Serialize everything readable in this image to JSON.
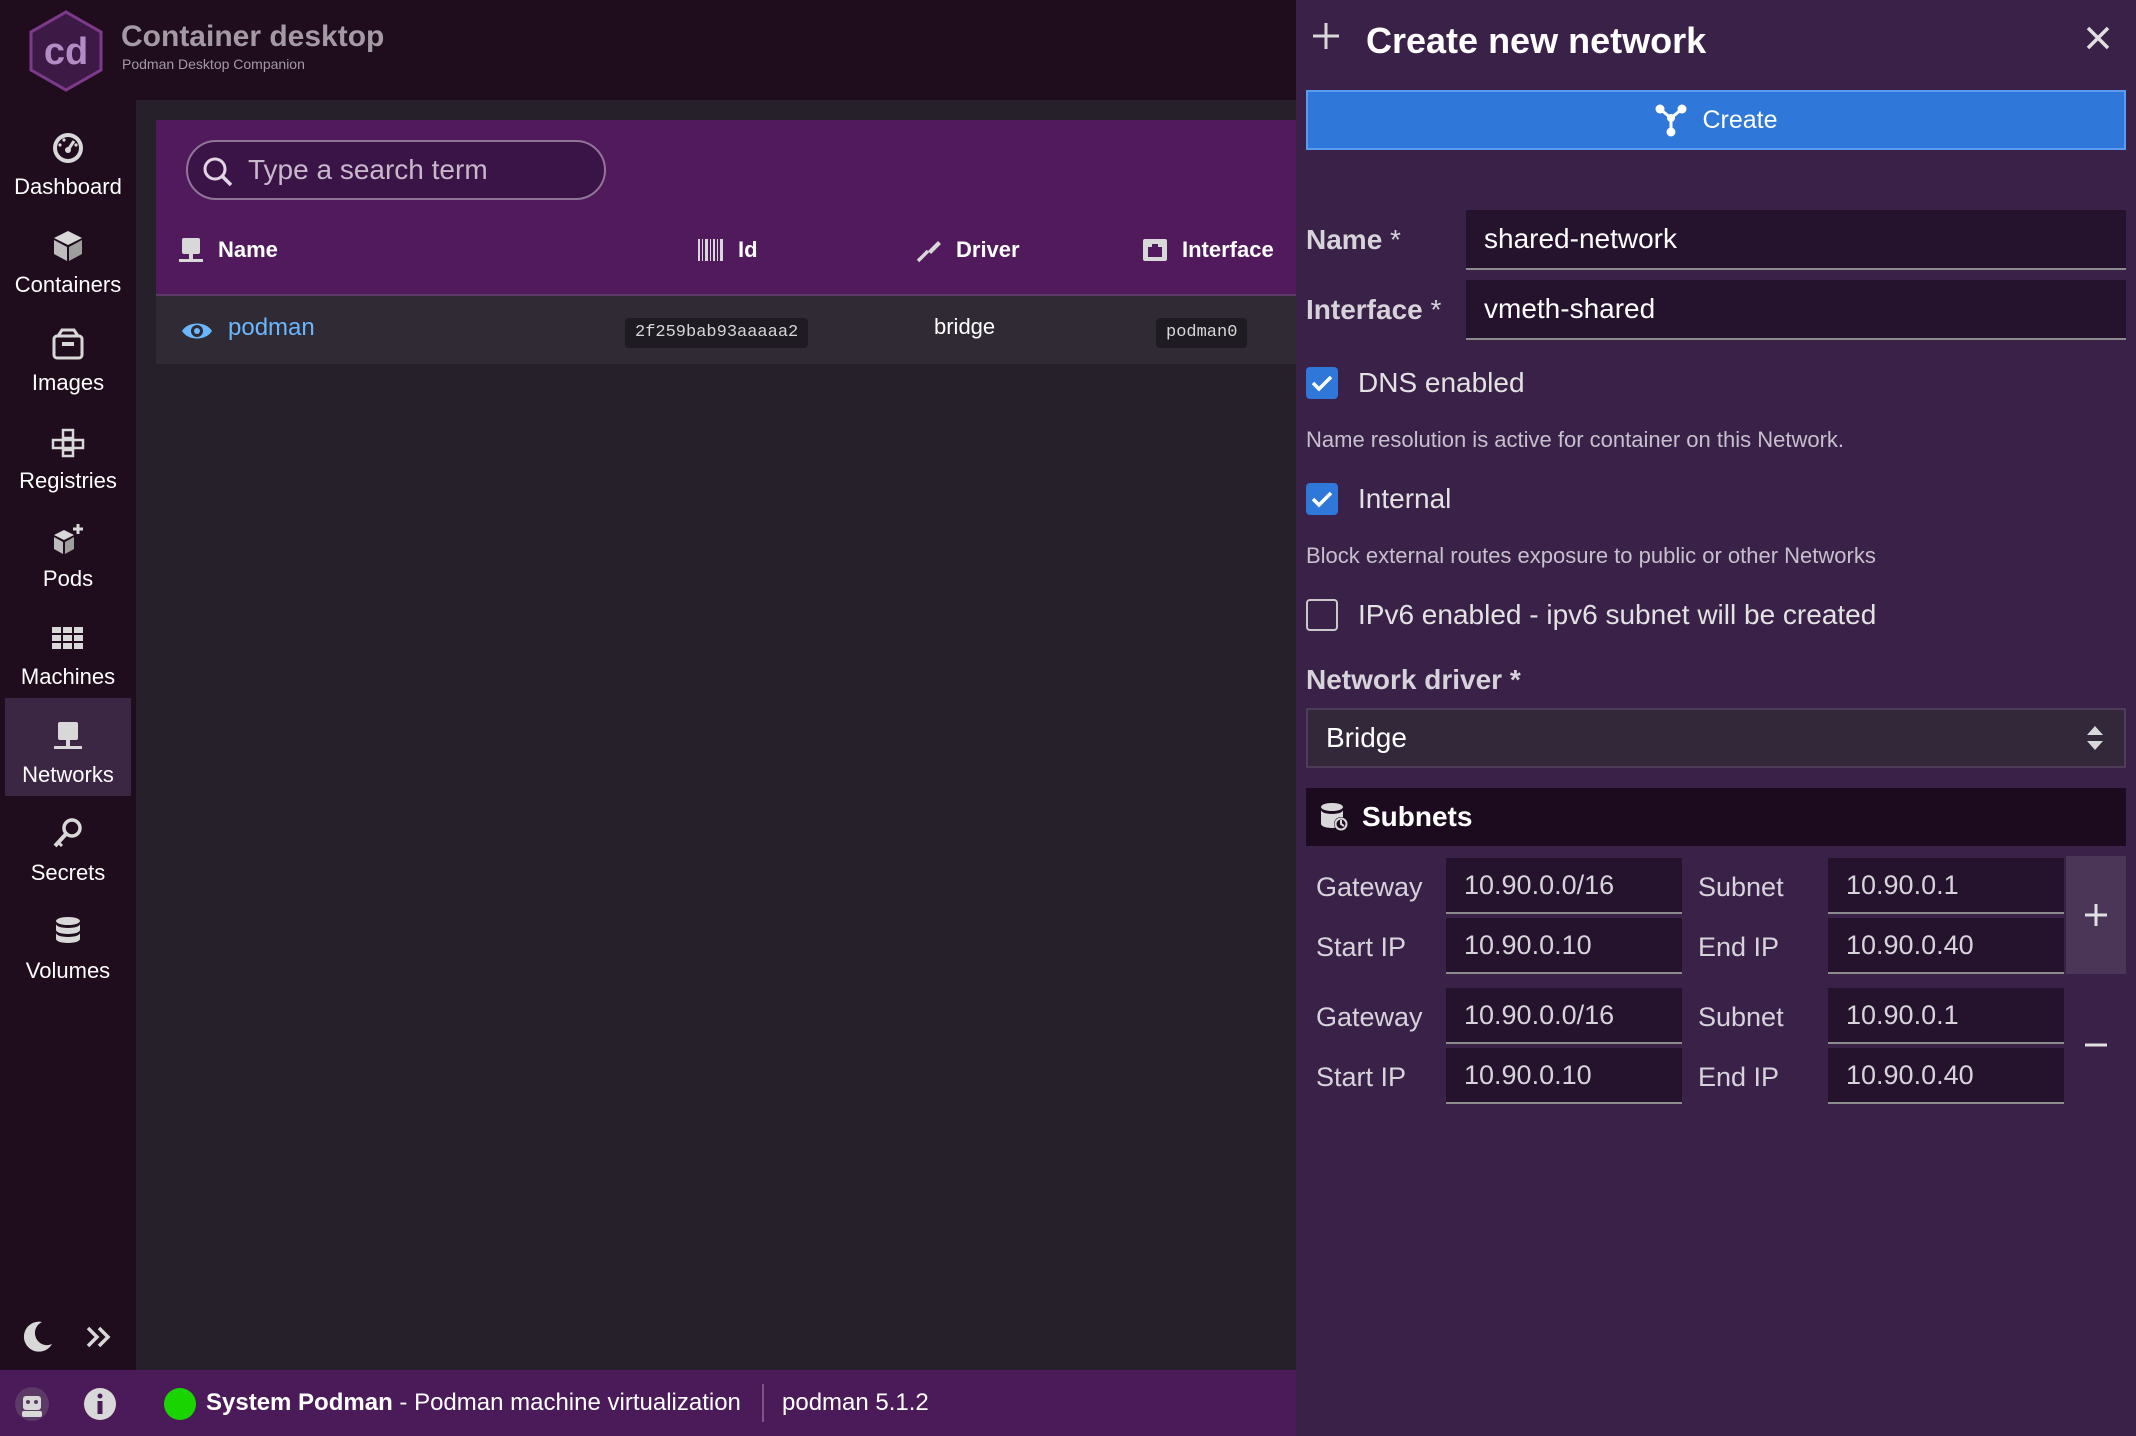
{
  "app": {
    "title": "Container desktop",
    "subtitle": "Podman Desktop Companion",
    "logo_text": "cd",
    "colors": {
      "accent": "#2f77d8",
      "header": "#501a5c",
      "status_ok": "#19d400",
      "link": "#6ab7ff"
    }
  },
  "sidebar": {
    "items": [
      {
        "label": "Dashboard",
        "icon": "dashboard-icon"
      },
      {
        "label": "Containers",
        "icon": "cube-icon"
      },
      {
        "label": "Images",
        "icon": "image-box-icon"
      },
      {
        "label": "Registries",
        "icon": "registry-icon"
      },
      {
        "label": "Pods",
        "icon": "pods-icon"
      },
      {
        "label": "Machines",
        "icon": "machines-grid-icon"
      },
      {
        "label": "Networks",
        "icon": "network-icon",
        "active": true
      },
      {
        "label": "Secrets",
        "icon": "key-icon"
      },
      {
        "label": "Volumes",
        "icon": "database-icon"
      }
    ]
  },
  "main": {
    "search": {
      "placeholder": "Type a search term",
      "value": ""
    },
    "columns": {
      "name": "Name",
      "id": "Id",
      "driver": "Driver",
      "interface": "Interface"
    },
    "rows": [
      {
        "name": "podman",
        "id": "2f259bab93aaaaa2",
        "driver": "bridge",
        "interface": "podman0"
      }
    ]
  },
  "status_bar": {
    "engine": "System Podman",
    "separator": " - ",
    "engine_desc": "Podman machine virtualization",
    "version": "podman 5.1.2"
  },
  "panel": {
    "title": "Create new network",
    "create_label": "Create",
    "name": {
      "label": "Name",
      "required": "*",
      "value": "shared-network"
    },
    "interface": {
      "label": "Interface",
      "required": "*",
      "value": "vmeth-shared"
    },
    "dns": {
      "label": "DNS enabled",
      "checked": true,
      "help": "Name resolution is active for container on this Network."
    },
    "internal": {
      "label": "Internal",
      "checked": true,
      "help": "Block external routes exposure to public or other Networks"
    },
    "ipv6": {
      "label": "IPv6 enabled - ipv6 subnet will be created",
      "checked": false
    },
    "driver": {
      "label": "Network driver *",
      "value": "Bridge"
    },
    "subnets": {
      "title": "Subnets",
      "labels": {
        "gateway": "Gateway",
        "subnet": "Subnet",
        "start_ip": "Start IP",
        "end_ip": "End IP"
      },
      "items": [
        {
          "gateway": "10.90.0.0/16",
          "subnet": "10.90.0.1",
          "start_ip": "10.90.0.10",
          "end_ip": "10.90.0.40"
        },
        {
          "gateway": "10.90.0.0/16",
          "subnet": "10.90.0.1",
          "start_ip": "10.90.0.10",
          "end_ip": "10.90.0.40"
        }
      ]
    }
  }
}
